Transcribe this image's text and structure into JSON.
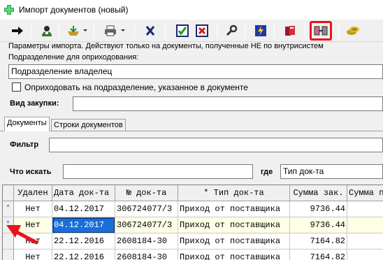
{
  "window": {
    "title": "Импорт документов (новый)"
  },
  "toolbar": {
    "buttons": [
      {
        "name": "arrow-right-icon"
      },
      {
        "name": "person-icon"
      },
      {
        "name": "import-dropdown-icon"
      },
      {
        "name": "print-dropdown-icon"
      },
      {
        "name": "cancel-x-icon"
      },
      {
        "name": "check-green-icon"
      },
      {
        "name": "cross-red-icon"
      },
      {
        "name": "wrench-icon"
      },
      {
        "name": "lightning-icon"
      },
      {
        "name": "book-icon"
      },
      {
        "name": "bind-icon"
      },
      {
        "name": "coins-icon"
      }
    ]
  },
  "params": {
    "note": "Параметры импорта. Действуют только на документы, полученные НЕ по внутрисистем",
    "subdivision_label": "Подразделение для оприходования:",
    "subdivision_value": "Подразделение владелец",
    "checkbox_label": "Оприходовать на подразделение, указанное в документе",
    "purchase_label": "Вид закупки:",
    "purchase_value": ""
  },
  "tabs": [
    {
      "label": "Документы",
      "active": true
    },
    {
      "label": "Строки документов",
      "active": false
    }
  ],
  "filter": {
    "filter_label": "Фильтр",
    "filter_value": "",
    "search_label": "Что искать",
    "search_value": "",
    "where_label": "где",
    "where_value": "Тип док-та"
  },
  "table": {
    "columns": [
      "Удален",
      "Дата док-та",
      "№ док-та",
      "* Тип док-та",
      "Сумма зак.",
      "Сумма п"
    ],
    "rows": [
      {
        "indicator": "*",
        "deleted": "Нет",
        "date": "04.12.2017",
        "number": "306724077/3",
        "type": "Приход от поставщика",
        "sum": "9736.44",
        "sum2": ""
      },
      {
        "indicator": "*",
        "deleted": "Нет",
        "date": "04.12.2017",
        "number": "306724077/3",
        "type": "Приход от поставщика",
        "sum": "9736.44",
        "sum2": ""
      },
      {
        "indicator": "",
        "deleted": "Нет",
        "date": "22.12.2016",
        "number": "2608184-30",
        "type": "Приход от поставщика",
        "sum": "7164.82",
        "sum2": ""
      },
      {
        "indicator": "",
        "deleted": "Нет",
        "date": "22.12.2016",
        "number": "2608184-30",
        "type": "Приход от поставщика",
        "sum": "7164.82",
        "sum2": ""
      }
    ],
    "selected_row": 1,
    "selected_column": "date"
  },
  "colors": {
    "highlight_annotation": "#e8141c",
    "selection": "#1a6ed8",
    "row_tint": "#ffffe6"
  }
}
